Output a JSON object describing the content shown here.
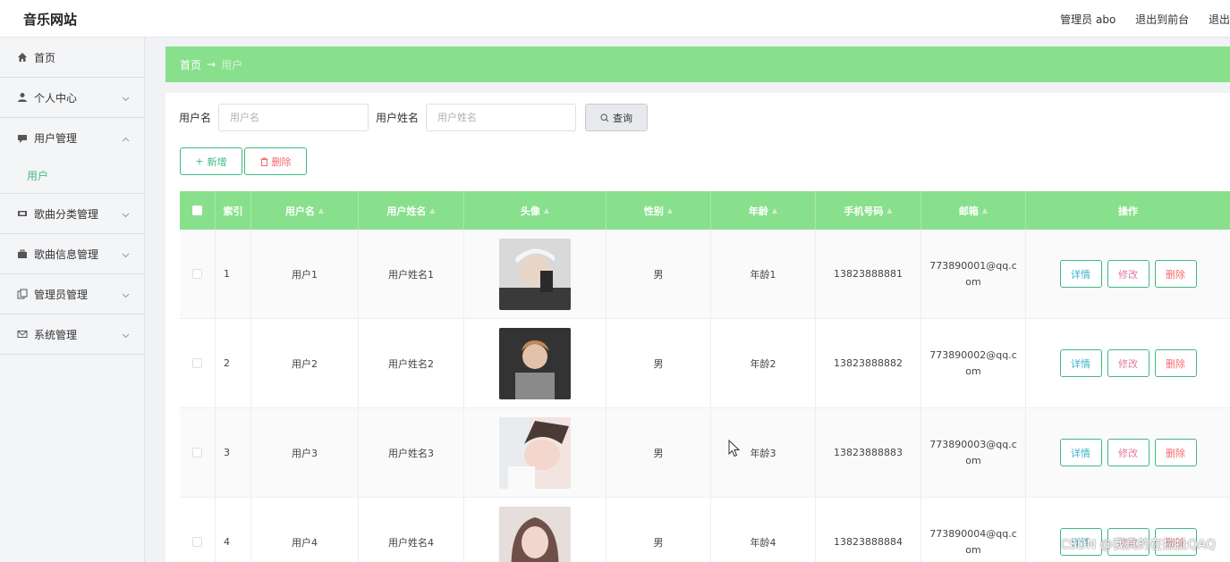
{
  "header": {
    "brand": "音乐网站",
    "admin": "管理员 abo",
    "exit_front": "退出到前台",
    "logout": "退出"
  },
  "sidebar": {
    "items": [
      {
        "label": "首页",
        "icon": "home-icon"
      },
      {
        "label": "个人中心",
        "icon": "user-icon"
      },
      {
        "label": "用户管理",
        "icon": "chat-icon",
        "sub": "用户"
      },
      {
        "label": "歌曲分类管理",
        "icon": "film-icon"
      },
      {
        "label": "歌曲信息管理",
        "icon": "briefcase-icon"
      },
      {
        "label": "管理员管理",
        "icon": "copy-icon"
      },
      {
        "label": "系统管理",
        "icon": "mail-icon"
      }
    ]
  },
  "breadcrumb": {
    "home": "首页",
    "sep": "→",
    "current": "用户"
  },
  "search": {
    "username_label": "用户名",
    "username_placeholder": "用户名",
    "realname_label": "用户姓名",
    "realname_placeholder": "用户姓名",
    "query_label": "查询"
  },
  "actions": {
    "add": "新增",
    "delete": "删除"
  },
  "table": {
    "columns": [
      "索引",
      "用户名",
      "用户姓名",
      "头像",
      "性别",
      "年龄",
      "手机号码",
      "邮箱",
      "操作"
    ],
    "ops": {
      "detail": "详情",
      "edit": "修改",
      "delete": "删除"
    },
    "rows": [
      {
        "index": "1",
        "username": "用户1",
        "realname": "用户姓名1",
        "gender": "男",
        "age": "年龄1",
        "phone": "13823888881",
        "email": "773890001@qq.com"
      },
      {
        "index": "2",
        "username": "用户2",
        "realname": "用户姓名2",
        "gender": "男",
        "age": "年龄2",
        "phone": "13823888882",
        "email": "773890002@qq.com"
      },
      {
        "index": "3",
        "username": "用户3",
        "realname": "用户姓名3",
        "gender": "男",
        "age": "年龄3",
        "phone": "13823888883",
        "email": "773890003@qq.com"
      },
      {
        "index": "4",
        "username": "用户4",
        "realname": "用户姓名4",
        "gender": "男",
        "age": "年龄4",
        "phone": "13823888884",
        "email": "773890004@qq.com"
      }
    ]
  },
  "watermark": "CSDN @我真的在拉扯QAQ",
  "colors": {
    "accent": "#88e08c",
    "green": "#41b883",
    "danger": "#f56c6c"
  }
}
